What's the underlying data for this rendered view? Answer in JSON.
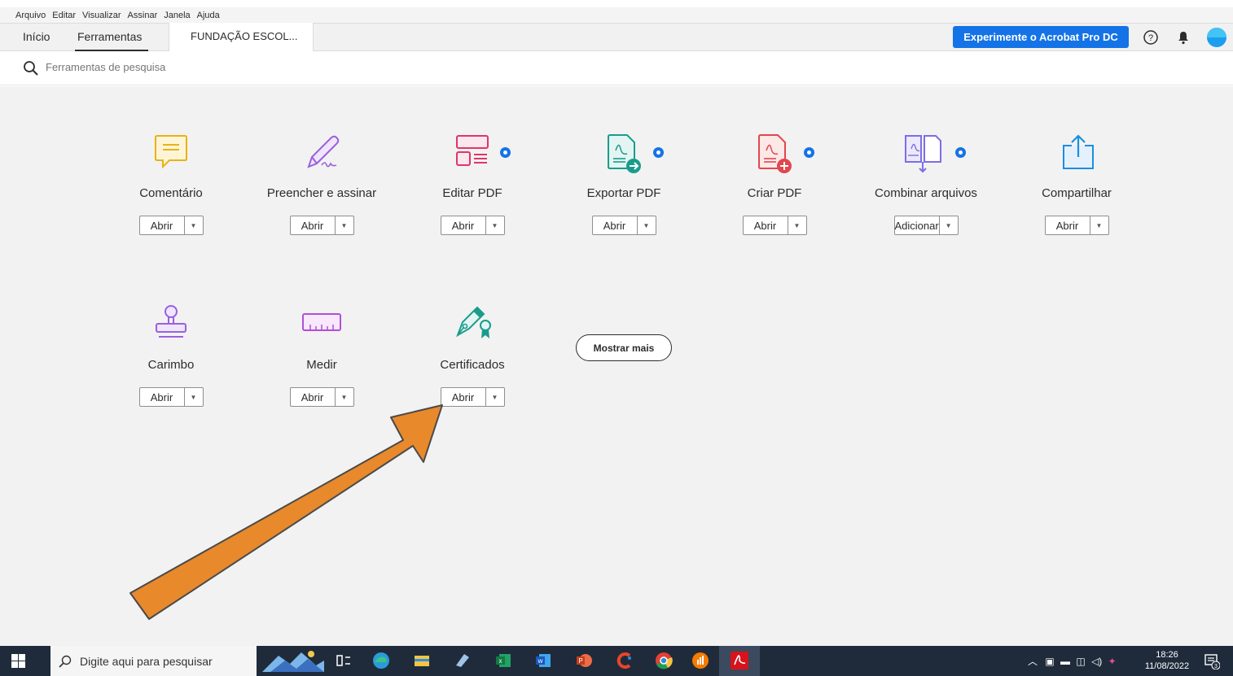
{
  "menu": [
    "Arquivo",
    "Editar",
    "Visualizar",
    "Assinar",
    "Janela",
    "Ajuda"
  ],
  "tabs": {
    "home": "Início",
    "tools": "Ferramentas",
    "document": "FUNDAÇÃO ESCOL..."
  },
  "header": {
    "try_button": "Experimente o Acrobat Pro DC"
  },
  "search": {
    "placeholder": "Ferramentas de pesquisa"
  },
  "tools": [
    {
      "label": "Comentário",
      "button": "Abrir",
      "icon": "comment-icon",
      "color": "#e8b217",
      "starred": false
    },
    {
      "label": "Preencher e assinar",
      "button": "Abrir",
      "icon": "fill-sign-icon",
      "color": "#9b5fe0",
      "starred": false
    },
    {
      "label": "Editar PDF",
      "button": "Abrir",
      "icon": "edit-pdf-icon",
      "color": "#e0356a",
      "starred": true
    },
    {
      "label": "Exportar PDF",
      "button": "Abrir",
      "icon": "export-pdf-icon",
      "color": "#1a9c8c",
      "starred": true
    },
    {
      "label": "Criar PDF",
      "button": "Abrir",
      "icon": "create-pdf-icon",
      "color": "#e0474f",
      "starred": true
    },
    {
      "label": "Combinar arquivos",
      "button": "Adicionar",
      "icon": "combine-files-icon",
      "color": "#7c6ee6",
      "starred": true
    },
    {
      "label": "Compartilhar",
      "button": "Abrir",
      "icon": "share-icon",
      "color": "#1b8fe0",
      "starred": false
    },
    {
      "label": "Carimbo",
      "button": "Abrir",
      "icon": "stamp-icon",
      "color": "#9b5fe0",
      "starred": false
    },
    {
      "label": "Medir",
      "button": "Abrir",
      "icon": "measure-icon",
      "color": "#b14fd6",
      "starred": false
    },
    {
      "label": "Certificados",
      "button": "Abrir",
      "icon": "certificate-icon",
      "color": "#1a9c8c",
      "starred": false
    }
  ],
  "show_more": "Mostrar mais",
  "taskbar": {
    "search_placeholder": "Digite aqui para pesquisar",
    "time": "18:26",
    "date": "11/08/2022",
    "notifications": "3"
  },
  "colors": {
    "accent": "#1473e6",
    "arrow": "#e8892c",
    "taskbar": "#1f2b3b"
  }
}
